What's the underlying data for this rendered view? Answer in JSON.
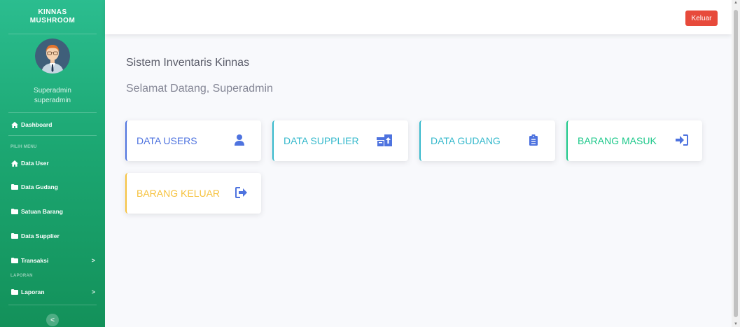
{
  "sidebar": {
    "brand_line1": "KINNAS",
    "brand_line2": "MUSHROOM",
    "user_role": "Superadmin",
    "user_name": "superadmin",
    "items": [
      {
        "label": "Dashboard",
        "icon": "home-icon"
      },
      {
        "label": "Data User",
        "icon": "home-icon"
      },
      {
        "label": "Data Gudang",
        "icon": "folder-icon"
      },
      {
        "label": "Satuan Barang",
        "icon": "folder-icon"
      },
      {
        "label": "Data Supplier",
        "icon": "folder-icon"
      },
      {
        "label": "Transaksi",
        "icon": "folder-icon",
        "chevron": ">"
      },
      {
        "label": "Laporan",
        "icon": "folder-icon",
        "chevron": ">"
      }
    ],
    "heading_menu": "PILIH MENU",
    "heading_report": "LAPORAN",
    "toggle_glyph": "<"
  },
  "topbar": {
    "logout_label": "Keluar"
  },
  "main": {
    "app_title": "Sistem Inventaris Kinnas",
    "welcome": "Selamat Datang, Superadmin"
  },
  "cards": [
    {
      "label": "DATA USERS",
      "color": "#4e73df",
      "icon": "user-icon"
    },
    {
      "label": "DATA SUPPLIER",
      "color": "#36b9cc",
      "icon": "boxes-icon"
    },
    {
      "label": "DATA GUDANG",
      "color": "#36b9cc",
      "icon": "clipboard-icon"
    },
    {
      "label": "BARANG MASUK",
      "color": "#1cc88a",
      "icon": "sign-in-icon"
    },
    {
      "label": "BARANG KELUAR",
      "color": "#f6c23e",
      "icon": "sign-out-icon"
    }
  ],
  "colors": {
    "sidebar_top": "#2bbd8f",
    "sidebar_bottom": "#13915a",
    "logout": "#e74a3b",
    "primary": "#4e73df",
    "info": "#36b9cc",
    "success": "#1cc88a",
    "warning": "#f6c23e"
  }
}
